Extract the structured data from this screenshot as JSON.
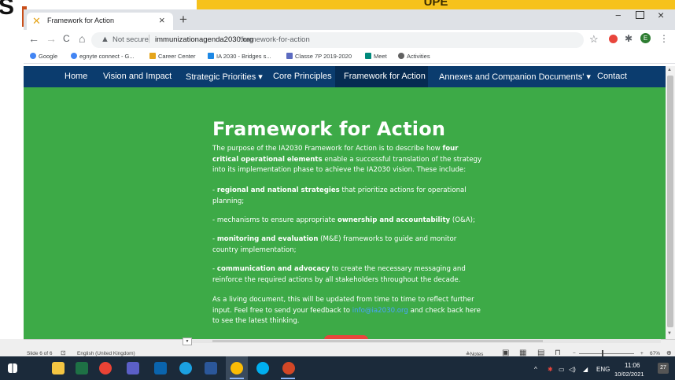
{
  "backdrop": {
    "slide_letter": "S",
    "banner_text": "UPE"
  },
  "browser": {
    "tab_title": "Framework for Action",
    "tab_close": "×",
    "new_tab": "+",
    "window_controls": {
      "minimize": "−",
      "close": "×"
    },
    "nav": {
      "back": "←",
      "forward": "→",
      "reload": "C",
      "home": "⌂"
    },
    "address": {
      "security_label": "Not secure",
      "separator": "|",
      "domain": "immunizationagenda2030.org",
      "path": "/framework-for-action"
    },
    "toolbar_icons": [
      "star-icon",
      "adblock-icon",
      "puzzle-icon",
      "profile-avatar",
      "menu-icon"
    ],
    "profile_initial": "E",
    "menu_glyph": "⋮",
    "star_glyph": "☆",
    "puzzle_glyph": "✱",
    "bookmarks": [
      {
        "label": "Google",
        "color": "#4285f4",
        "icon": "google-icon"
      },
      {
        "label": "egnyte connect - G...",
        "color": "#4285f4",
        "icon": "google-icon"
      },
      {
        "label": "Career Center",
        "color": "#e5a51b",
        "icon": "career-center-icon"
      },
      {
        "label": "IA 2030 - Bridges s...",
        "color": "#1e88e5",
        "icon": "drive-icon"
      },
      {
        "label": "Classe 7P 2019-2020",
        "color": "#5c6bc0",
        "icon": "classroom-icon"
      },
      {
        "label": "Meet",
        "color": "#00897b",
        "icon": "meet-icon"
      },
      {
        "label": "Activities",
        "color": "#616161",
        "icon": "activities-icon"
      }
    ]
  },
  "site": {
    "nav": [
      "Home",
      "Vision and Impact",
      "Strategic Priorities ▾",
      "Core Principles",
      "Framework for Action",
      "Annexes and Companion Documents' ▾",
      "Contact"
    ],
    "active_nav": "Framework for Action",
    "title": "Framework for Action",
    "intro_1": "The purpose of the IA2030 Framework for Action is to describe how ",
    "intro_bold": "four critical operational elements",
    "intro_2": " enable a successful translation of the strategy into its implementation phase to achieve the IA2030 vision. These include:",
    "item1_pre": "- ",
    "item1_bold": "regional and national strategies",
    "item1_rest": " that prioritize actions for operational planning;",
    "item2_pre": "- mechanisms to ensure appropriate ",
    "item2_bold": "ownership and accountability",
    "item2_rest": " (O&A);",
    "item3_pre": "- ",
    "item3_bold": "monitoring and evaluation",
    "item3_rest": " (M&E) frameworks to guide and monitor country implementation;",
    "item4_pre": "- ",
    "item4_bold": "communication and advocacy",
    "item4_rest": " to create the necessary messaging and reinforce the required actions by all stakeholders throughout the decade.",
    "closing_1": "As a living document, this will be updated from time to time to reflect further input. Feel free to send your feedback to ",
    "closing_link": "info@ia2030.org",
    "closing_2": " and check back here to see the latest thinking."
  },
  "powerpoint_status": {
    "slide": "Slide 6 of 6",
    "language": "English (United Kingdom)",
    "notes": "Notes",
    "zoom": "67%",
    "zoom_minus": "−",
    "zoom_plus": "+"
  },
  "taskbar": {
    "apps": [
      "start-icon",
      "file-explorer-icon",
      "excel-icon",
      "chrome-icon",
      "teams-icon",
      "outlook-icon",
      "edge-icon",
      "word-icon",
      "chrome-active-icon",
      "skype-icon",
      "powerpoint-icon"
    ],
    "tray_caret": "^",
    "language": "ENG",
    "time": "11:06",
    "date": "10/02/2021",
    "notifications": "27"
  }
}
